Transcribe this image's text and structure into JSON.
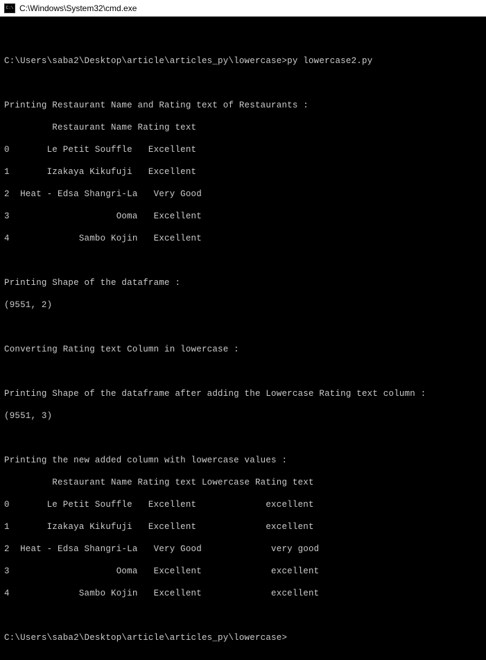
{
  "titlebar": {
    "path": "C:\\Windows\\System32\\cmd.exe"
  },
  "prompt1": {
    "path": "C:\\Users\\saba2\\Desktop\\article\\articles_py\\lowercase>",
    "command": "py lowercase2.py"
  },
  "section1": {
    "header": "Printing Restaurant Name and Rating text of Restaurants :",
    "colheader": "         Restaurant Name Rating text",
    "rows": [
      "0       Le Petit Souffle   Excellent",
      "1       Izakaya Kikufuji   Excellent",
      "2  Heat - Edsa Shangri-La   Very Good",
      "3                    Ooma   Excellent",
      "4             Sambo Kojin   Excellent"
    ]
  },
  "section2": {
    "header": "Printing Shape of the dataframe :",
    "value": "(9551, 2)"
  },
  "section3": {
    "header": "Converting Rating text Column in lowercase :"
  },
  "section4": {
    "header": "Printing Shape of the dataframe after adding the Lowercase Rating text column :",
    "value": "(9551, 3)"
  },
  "section5": {
    "header": "Printing the new added column with lowercase values :",
    "colheader": "         Restaurant Name Rating text Lowercase Rating text",
    "rows": [
      "0       Le Petit Souffle   Excellent             excellent",
      "1       Izakaya Kikufuji   Excellent             excellent",
      "2  Heat - Edsa Shangri-La   Very Good             very good",
      "3                    Ooma   Excellent             excellent",
      "4             Sambo Kojin   Excellent             excellent"
    ]
  },
  "prompt2": {
    "path": "C:\\Users\\saba2\\Desktop\\article\\articles_py\\lowercase>"
  }
}
